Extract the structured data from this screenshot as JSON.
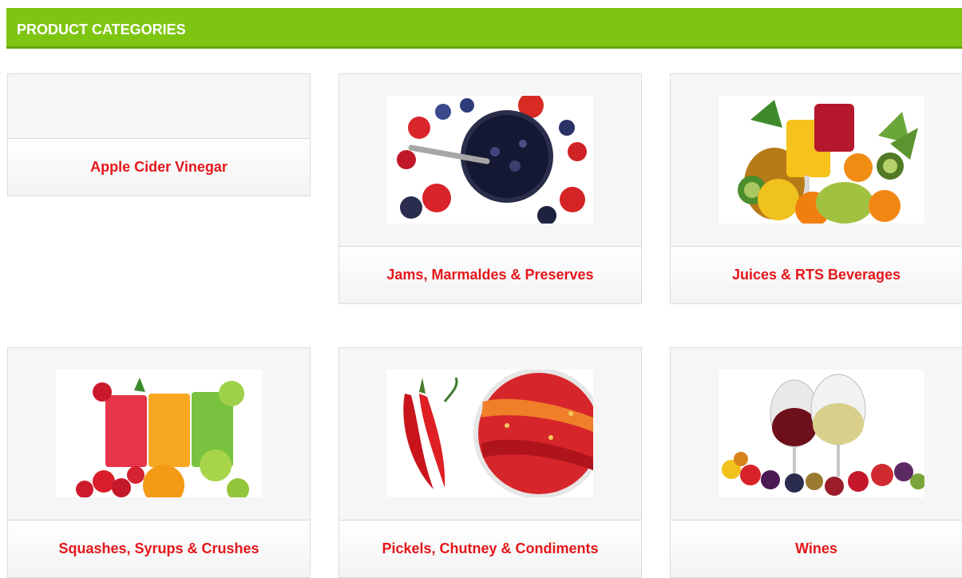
{
  "header": {
    "title": "PRODUCT CATEGORIES"
  },
  "categories": [
    {
      "label": "Apple Cider Vinegar",
      "icon": "apple-cider-vinegar-image"
    },
    {
      "label": "Jams, Marmaldes & Preserves",
      "icon": "jam-berries-image"
    },
    {
      "label": "Juices & RTS Beverages",
      "icon": "fruit-juices-image"
    },
    {
      "label": "Squashes, Syrups & Crushes",
      "icon": "squash-drinks-image"
    },
    {
      "label": "Pickels, Chutney & Condiments",
      "icon": "red-chili-image"
    },
    {
      "label": "Wines",
      "icon": "wine-glasses-image"
    }
  ],
  "colors": {
    "header_bg": "#7ec512",
    "label_text": "#e5161a"
  }
}
